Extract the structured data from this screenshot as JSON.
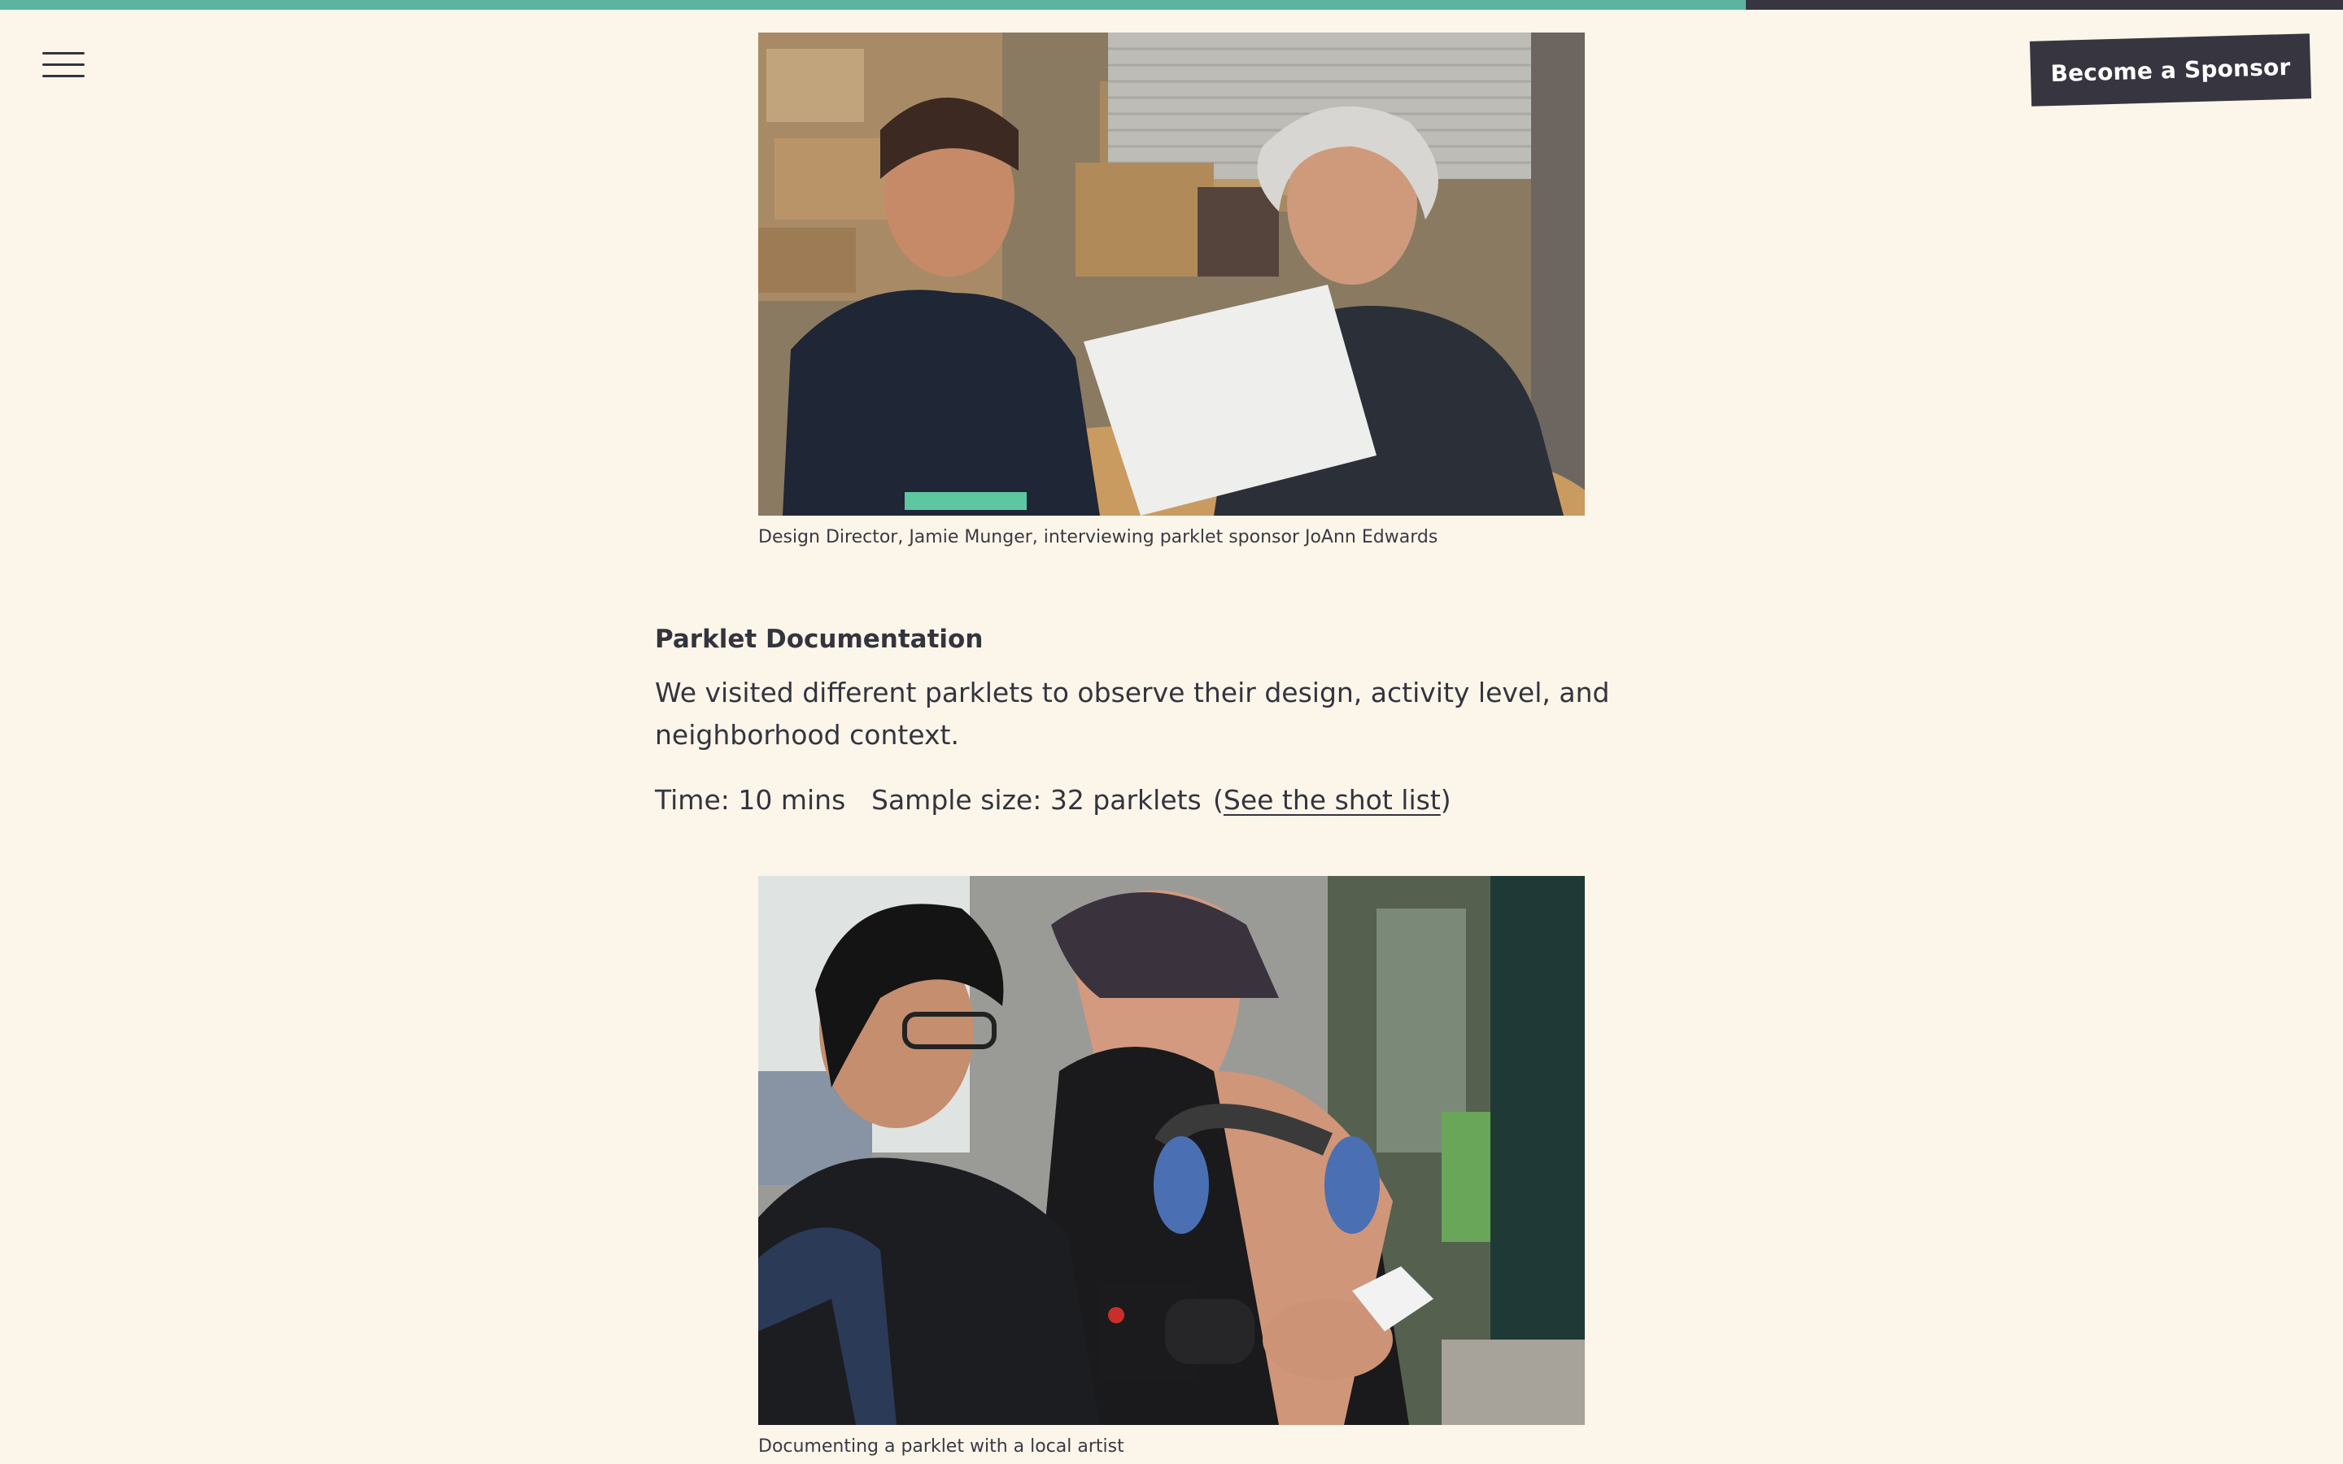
{
  "header": {
    "reading_progress": 0.745,
    "menu_icon": "hamburger-menu-icon",
    "sponsor_button_label": "Become a Sponsor"
  },
  "figures": [
    {
      "caption": "Design Director, Jamie Munger, interviewing parklet sponsor JoAnn Edwards"
    },
    {
      "caption": "Documenting a parklet with a local artist"
    }
  ],
  "section": {
    "title": "Parklet Documentation",
    "body": "We visited different parklets to observe their design, activity level, and neighborhood context.",
    "time": "Time: 10 mins",
    "sample_size": "Sample size: 32 parklets",
    "link_open": "(",
    "link_label": "See the shot list",
    "link_close": ")"
  },
  "colors": {
    "background": "#fcf6ea",
    "accent": "#5cb3a2",
    "dark": "#373640"
  }
}
